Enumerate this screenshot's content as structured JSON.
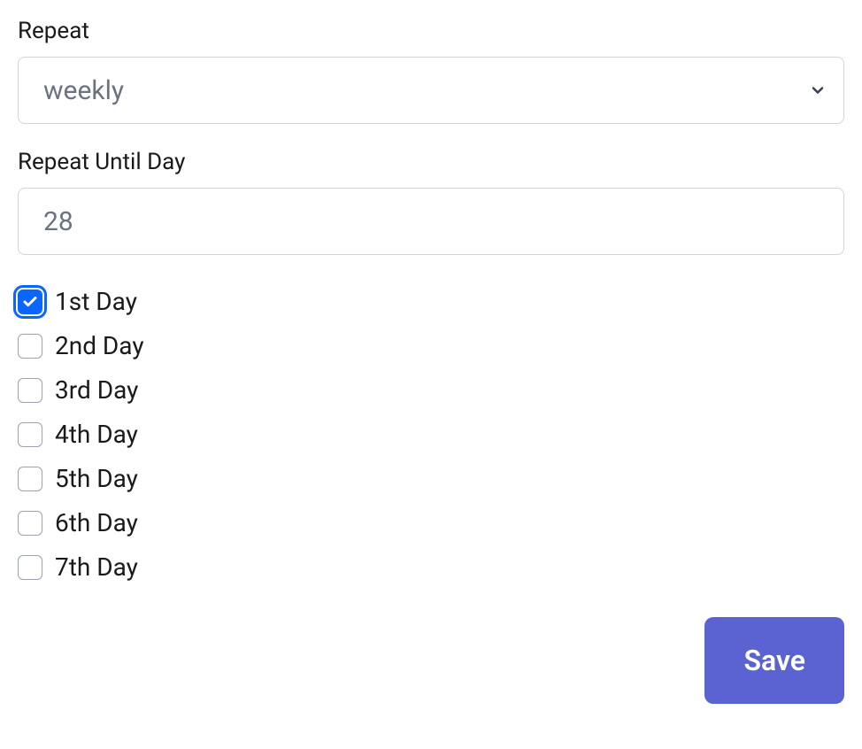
{
  "repeat": {
    "label": "Repeat",
    "value": "weekly"
  },
  "repeatUntil": {
    "label": "Repeat Until Day",
    "value": "28"
  },
  "days": [
    {
      "label": "1st Day",
      "checked": true,
      "focused": true
    },
    {
      "label": "2nd Day",
      "checked": false,
      "focused": false
    },
    {
      "label": "3rd Day",
      "checked": false,
      "focused": false
    },
    {
      "label": "4th Day",
      "checked": false,
      "focused": false
    },
    {
      "label": "5th Day",
      "checked": false,
      "focused": false
    },
    {
      "label": "6th Day",
      "checked": false,
      "focused": false
    },
    {
      "label": "7th Day",
      "checked": false,
      "focused": false
    }
  ],
  "actions": {
    "save": "Save"
  }
}
